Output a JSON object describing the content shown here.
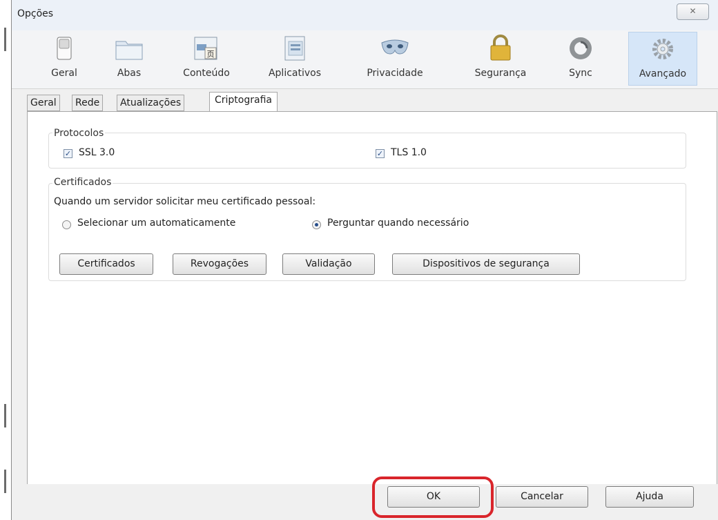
{
  "window": {
    "title": "Opções",
    "close_glyph": "✕"
  },
  "toolbar": {
    "items": [
      {
        "label": "Geral",
        "icon": "switch-icon"
      },
      {
        "label": "Abas",
        "icon": "tabs-folder-icon"
      },
      {
        "label": "Conteúdo",
        "icon": "content-icon"
      },
      {
        "label": "Aplicativos",
        "icon": "applications-icon"
      },
      {
        "label": "Privacidade",
        "icon": "privacy-mask-icon"
      },
      {
        "label": "Segurança",
        "icon": "padlock-icon"
      },
      {
        "label": "Sync",
        "icon": "sync-icon"
      },
      {
        "label": "Avançado",
        "icon": "gear-icon"
      }
    ],
    "selected": "Avançado"
  },
  "tabs": [
    "Geral",
    "Rede",
    "Atualizações",
    "Criptografia"
  ],
  "active_tab": "Criptografia",
  "protocols": {
    "title": "Protocolos",
    "ssl": {
      "label": "SSL 3.0",
      "checked": true
    },
    "tls": {
      "label": "TLS 1.0",
      "checked": true
    }
  },
  "certificates": {
    "title": "Certificados",
    "prompt": "Quando um servidor solicitar meu certificado pessoal:",
    "options": [
      {
        "label": "Selecionar um automaticamente",
        "selected": false
      },
      {
        "label": "Perguntar quando necessário",
        "selected": true
      }
    ],
    "buttons": [
      "Certificados",
      "Revogações",
      "Validação",
      "Dispositivos de segurança"
    ]
  },
  "footer": {
    "ok": "OK",
    "cancel": "Cancelar",
    "help": "Ajuda"
  },
  "colors": {
    "highlight": "#d9252b",
    "selected_bg": "#d6e6f8"
  }
}
